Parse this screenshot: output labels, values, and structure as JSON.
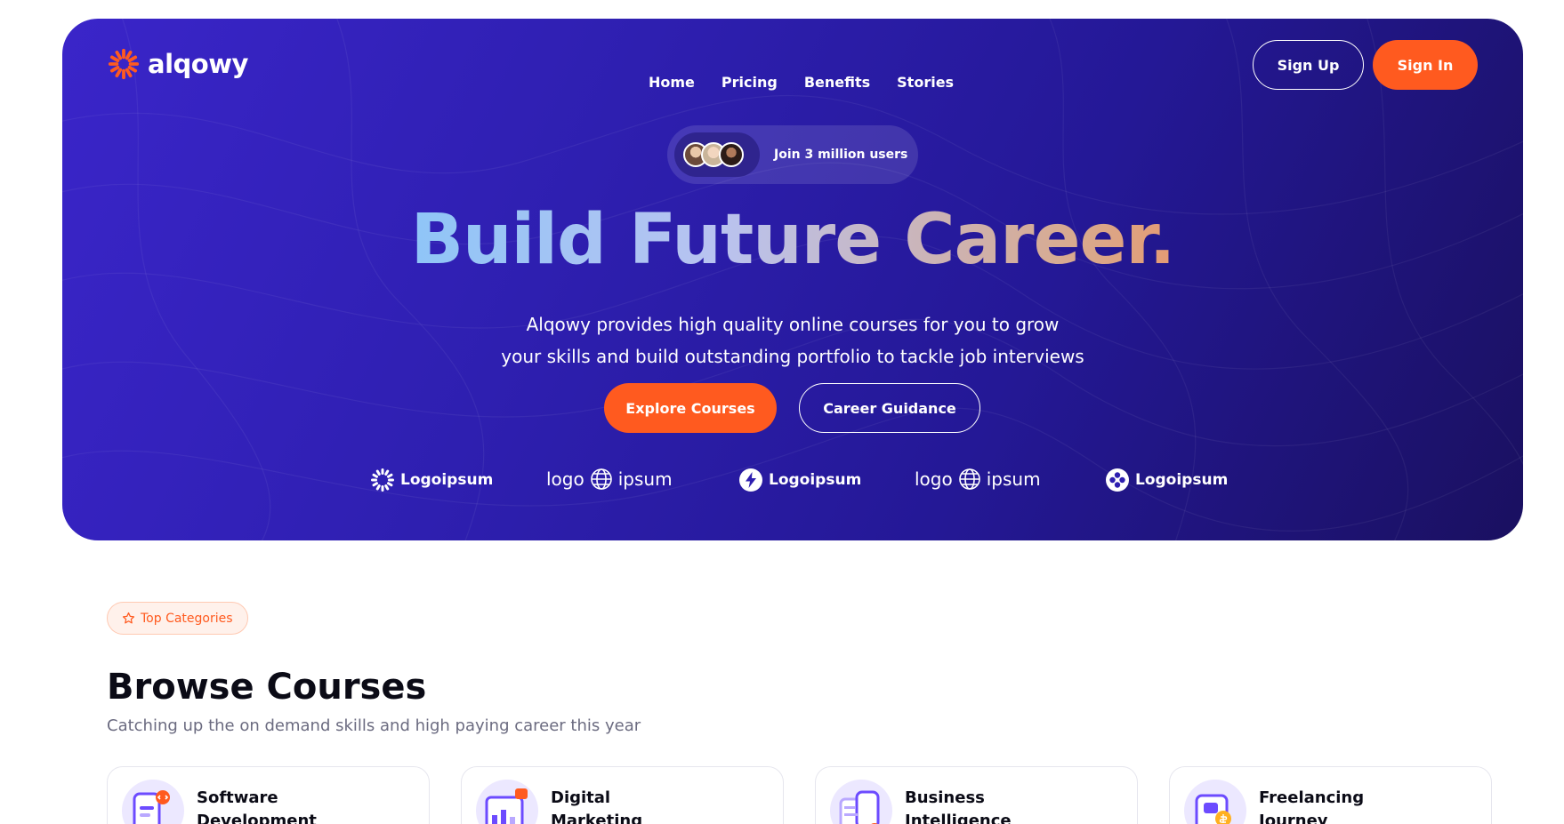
{
  "brand": {
    "name": "alqowy"
  },
  "nav": {
    "items": [
      "Home",
      "Pricing",
      "Benefits",
      "Stories"
    ]
  },
  "auth": {
    "signup": "Sign Up",
    "signin": "Sign In"
  },
  "hero": {
    "badge": "Join 3 million users",
    "headline": "Build Future Career.",
    "subtitle_line1": "Alqowy provides high quality online courses for you to grow",
    "subtitle_line2": "your skills and build outstanding portfolio to tackle job interviews",
    "primary_cta": "Explore Courses",
    "secondary_cta": "Career Guidance"
  },
  "partners": [
    {
      "icon": "sunburst-icon",
      "text": "Logoipsum"
    },
    {
      "icon": "globe-icon",
      "text_left": "logo",
      "text_right": "ipsum"
    },
    {
      "icon": "bolt-icon",
      "text": "Logoipsum"
    },
    {
      "icon": "globe-icon",
      "text_left": "logo",
      "text_right": "ipsum"
    },
    {
      "icon": "quad-icon",
      "text": "Logoipsum"
    }
  ],
  "section": {
    "chip": "Top Categories",
    "title": "Browse Courses",
    "subtitle": "Catching up the on demand skills and high paying career this year"
  },
  "categories": [
    {
      "title": "Software Development"
    },
    {
      "title": "Digital Marketing"
    },
    {
      "title": "Business Intelligence"
    },
    {
      "title": "Freelancing Journey"
    }
  ],
  "colors": {
    "accent": "#ff5a1f",
    "hero_bg": "#2e1fb0",
    "text_dark": "#0b0b16"
  }
}
